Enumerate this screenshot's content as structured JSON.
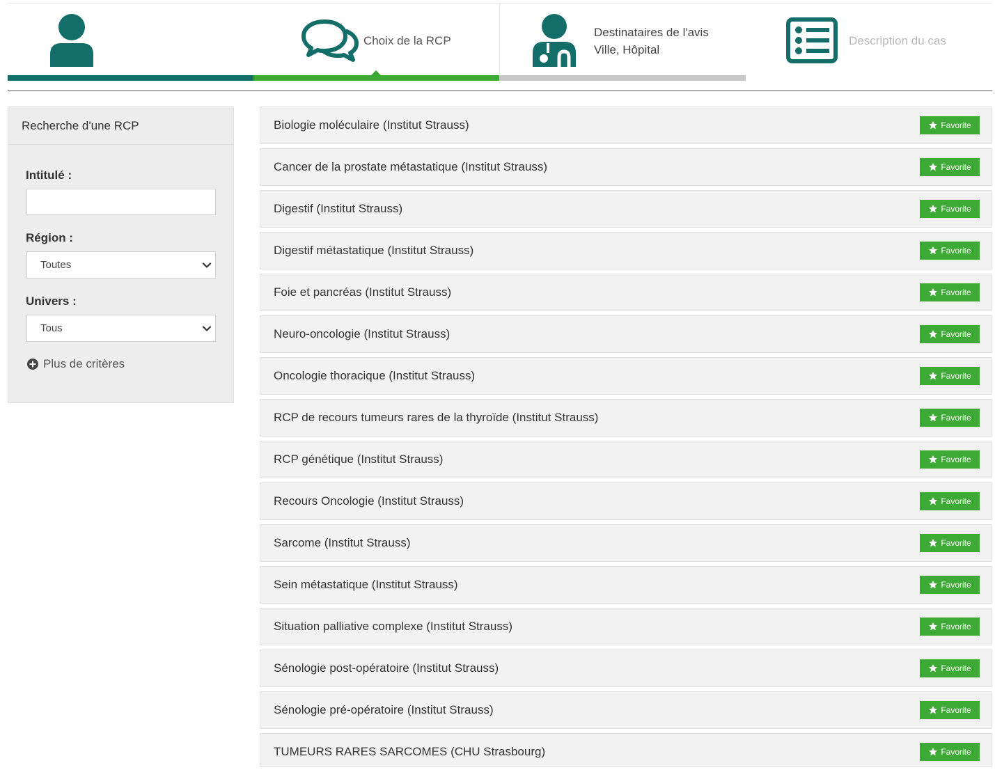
{
  "steps": [
    {
      "name": "patient",
      "label": "",
      "label_line2": "",
      "icon": "user-icon",
      "state": "done"
    },
    {
      "name": "rcp-choice",
      "label": "Choix de la RCP",
      "label_line2": "",
      "icon": "chat-bubbles-icon",
      "state": "active"
    },
    {
      "name": "recipients",
      "label": "Destinataires de l'avis",
      "label_line2": "Ville, Hôpital",
      "icon": "doctor-icon",
      "state": "pending"
    },
    {
      "name": "case-description",
      "label": "Description du cas",
      "label_line2": "",
      "icon": "list-icon",
      "state": "disabled"
    }
  ],
  "colors": {
    "teal": "#136d69",
    "green": "#3daa35",
    "gray_bar": "#c8c8c8",
    "disabled_text": "#b8b8b8"
  },
  "sidebar": {
    "title": "Recherche d'une RCP",
    "intitule_label": "Intitulé :",
    "intitule_value": "",
    "region_label": "Région :",
    "region_value": "Toutes",
    "univers_label": "Univers :",
    "univers_value": "Tous",
    "more_criteria": "Plus de critères"
  },
  "rcp_list": {
    "favorite_label": "Favorite",
    "items": [
      "Biologie moléculaire (Institut Strauss)",
      "Cancer de la prostate métastatique (Institut Strauss)",
      "Digestif (Institut Strauss)",
      "Digestif métastatique (Institut Strauss)",
      "Foie et pancréas (Institut Strauss)",
      "Neuro-oncologie (Institut Strauss)",
      "Oncologie thoracique (Institut Strauss)",
      "RCP de recours tumeurs rares de la thyroïde (Institut Strauss)",
      "RCP génétique (Institut Strauss)",
      "Recours Oncologie (Institut Strauss)",
      "Sarcome (Institut Strauss)",
      "Sein métastatique (Institut Strauss)",
      "Situation palliative complexe (Institut Strauss)",
      "Sénologie post-opératoire (Institut Strauss)",
      "Sénologie pré-opératoire (Institut Strauss)",
      "TUMEURS RARES SARCOMES (CHU Strasbourg)"
    ]
  }
}
